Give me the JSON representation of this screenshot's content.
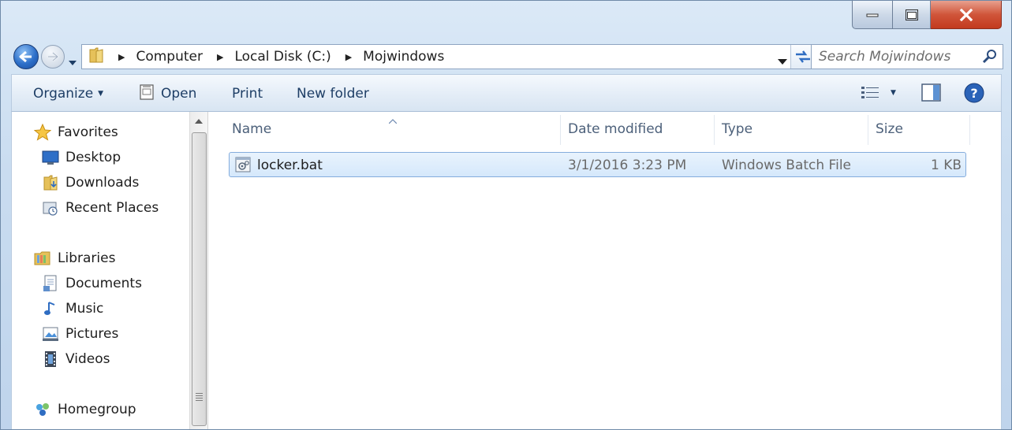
{
  "window": {
    "controls": {
      "minimize_icon": "minimize-icon",
      "maximize_icon": "maximize-icon",
      "close_icon": "close-icon"
    }
  },
  "navigation": {
    "breadcrumbs": [
      "Computer",
      "Local Disk (C:)",
      "Mojwindows"
    ],
    "search_placeholder": "Search Mojwindows"
  },
  "toolbar": {
    "organize_label": "Organize",
    "open_label": "Open",
    "print_label": "Print",
    "new_folder_label": "New folder"
  },
  "nav_pane": {
    "favorites": {
      "label": "Favorites",
      "items": [
        {
          "label": "Desktop",
          "icon": "desktop-icon"
        },
        {
          "label": "Downloads",
          "icon": "downloads-folder-icon"
        },
        {
          "label": "Recent Places",
          "icon": "recent-places-icon"
        }
      ]
    },
    "libraries": {
      "label": "Libraries",
      "items": [
        {
          "label": "Documents",
          "icon": "documents-icon"
        },
        {
          "label": "Music",
          "icon": "music-icon"
        },
        {
          "label": "Pictures",
          "icon": "pictures-icon"
        },
        {
          "label": "Videos",
          "icon": "videos-icon"
        }
      ]
    },
    "homegroup": {
      "label": "Homegroup"
    }
  },
  "file_list": {
    "columns": [
      "Name",
      "Date modified",
      "Type",
      "Size"
    ],
    "rows": [
      {
        "name": "locker.bat",
        "date_modified": "3/1/2016 3:23 PM",
        "type": "Windows Batch File",
        "size": "1 KB",
        "selected": true
      }
    ]
  },
  "colors": {
    "selection_fill": "#d5e8fb",
    "selection_border": "#84acdd",
    "command_text": "#1e3e66",
    "close_button": "#c23a1e"
  }
}
